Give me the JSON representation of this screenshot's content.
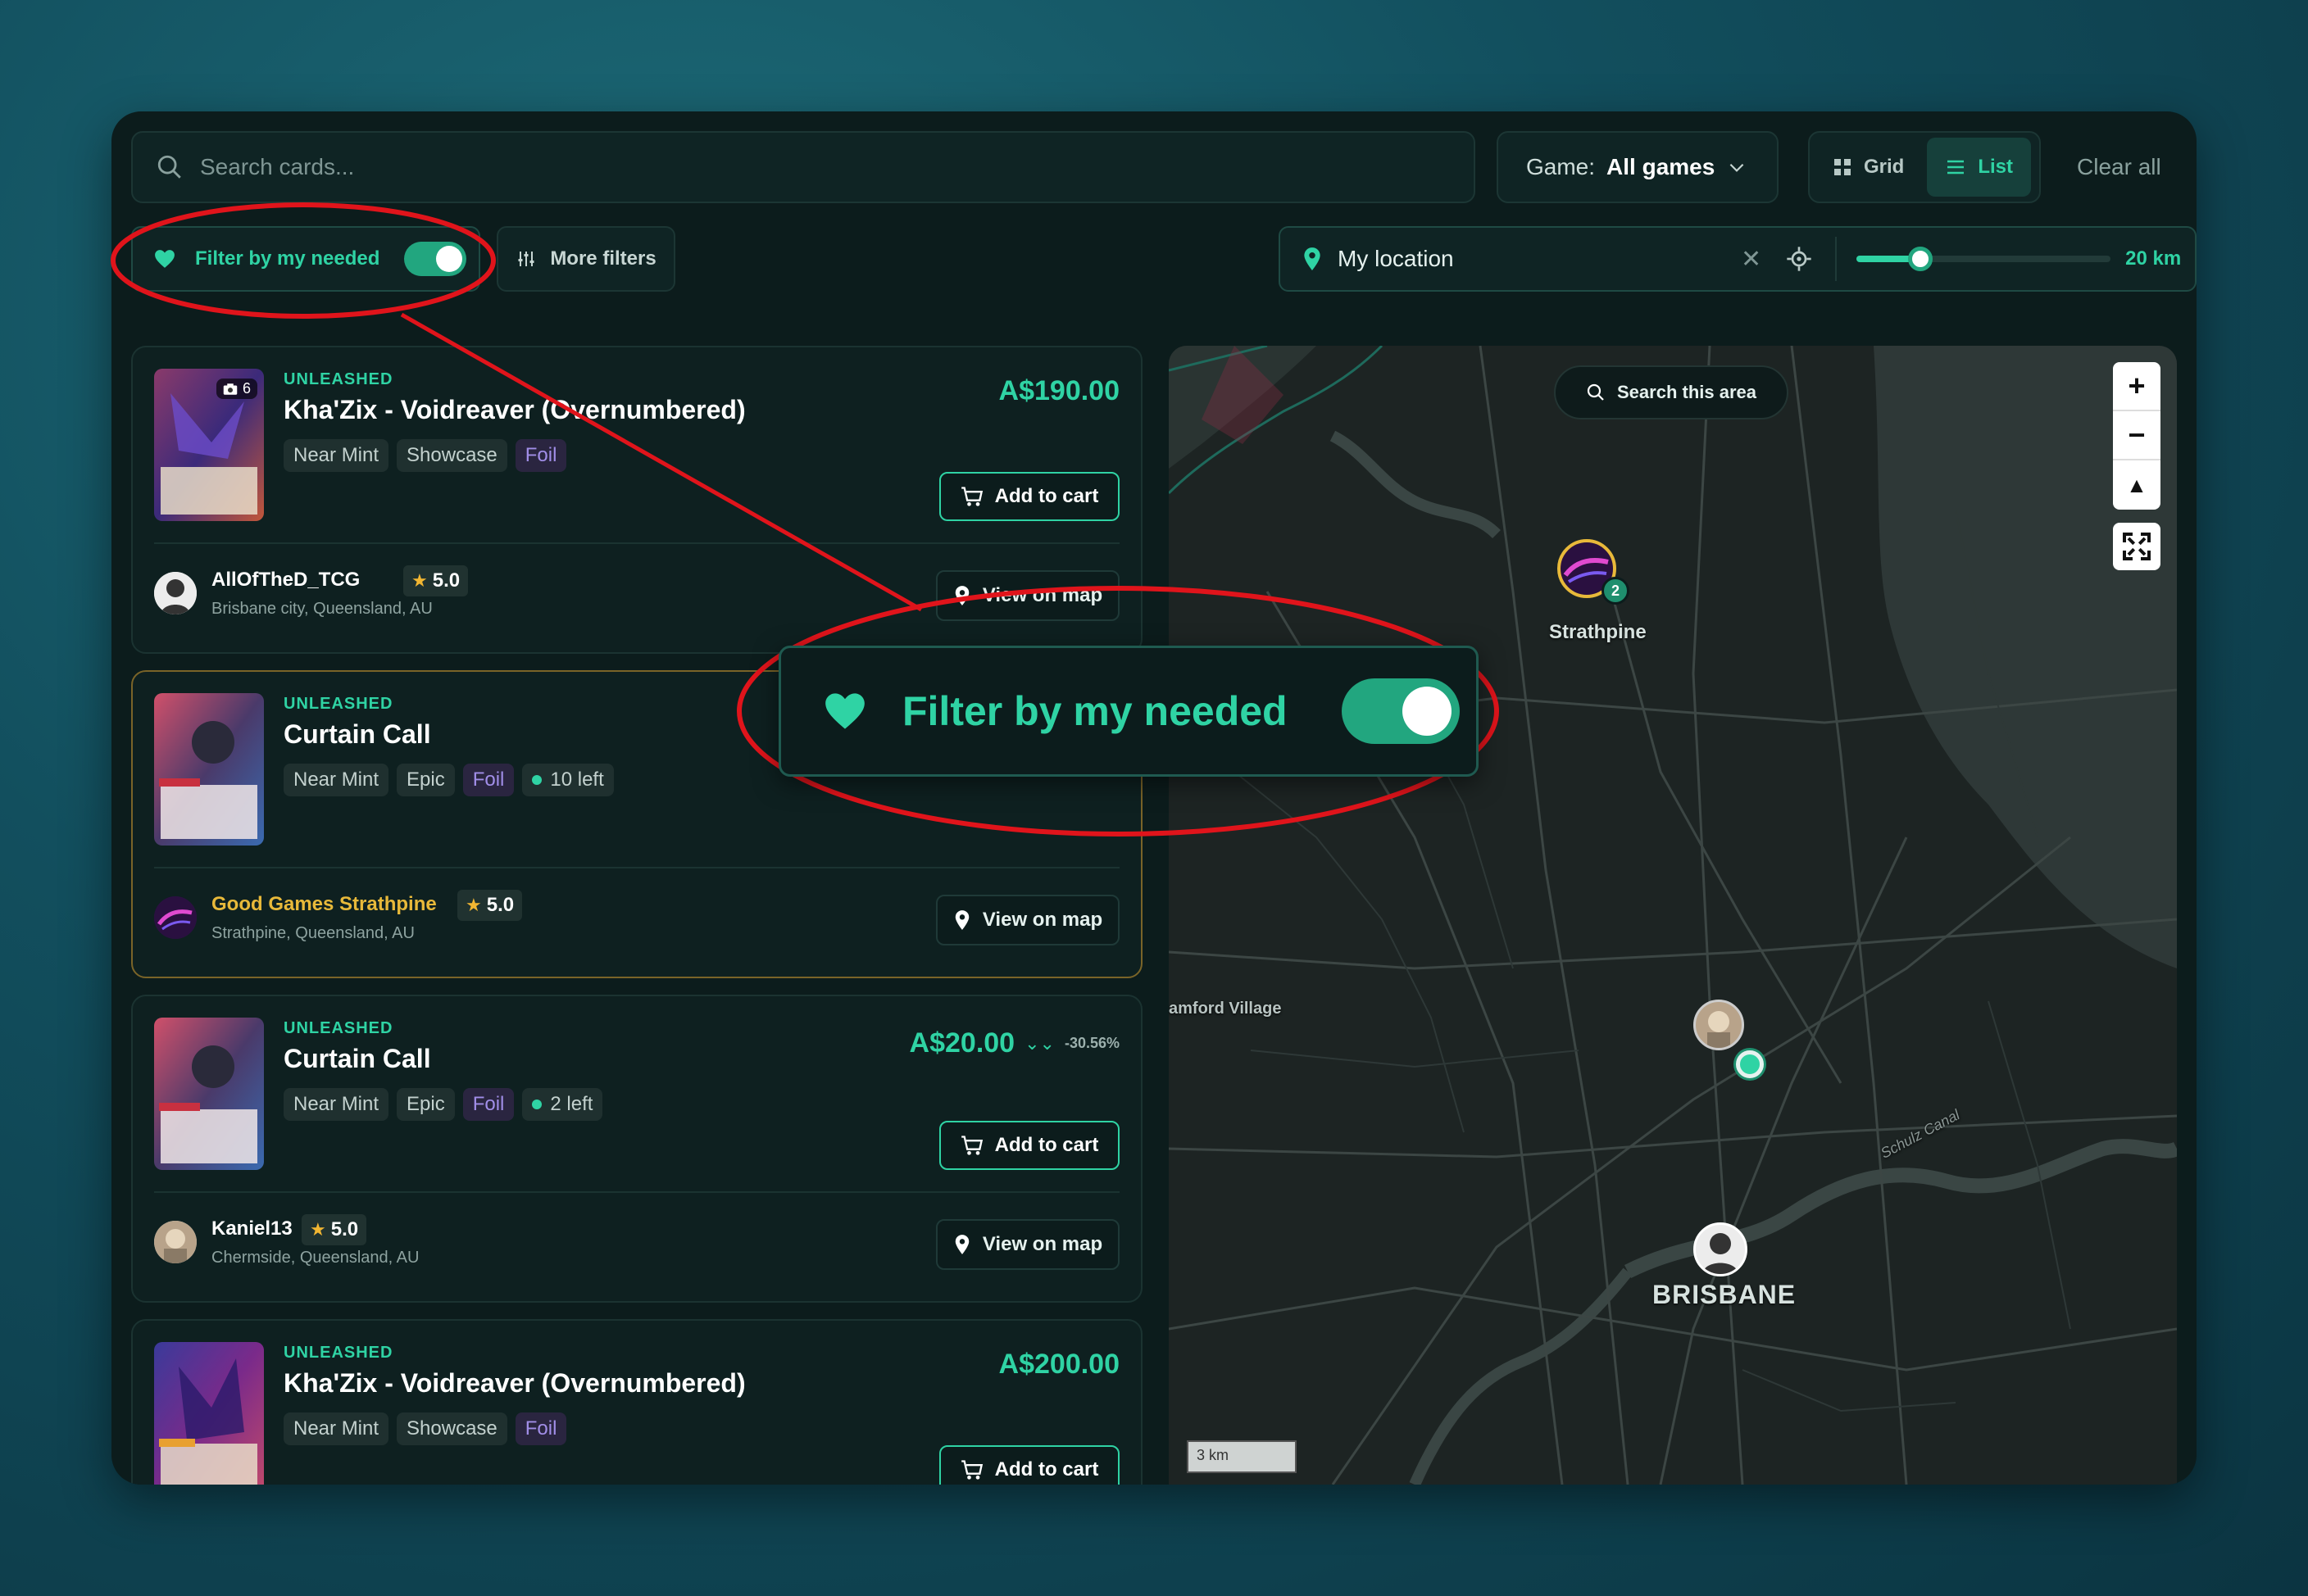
{
  "toolbar": {
    "search_placeholder": "Search cards...",
    "game_label": "Game:",
    "game_value": "All games",
    "view_grid": "Grid",
    "view_list": "List",
    "active_view": "List",
    "clear_all": "Clear all"
  },
  "filters": {
    "needed_label": "Filter by my needed",
    "needed_enabled": true,
    "more_filters": "More filters"
  },
  "location": {
    "value": "My location",
    "radius_label": "20 km",
    "radius_fraction": 0.25
  },
  "listings": [
    {
      "set": "UNLEASHED",
      "name": "Kha'Zix - Voidreaver (Overnumbered)",
      "photo_count": "6",
      "tags": [
        "Near Mint",
        "Showcase",
        "Foil"
      ],
      "price": "A$190.00",
      "cart": "Add to cart",
      "seller": "AllOfTheD_TCG",
      "rating": "5.0",
      "seller_location": "Brisbane city, Queensland, AU",
      "map_button": "View on map"
    },
    {
      "set": "UNLEASHED",
      "name": "Curtain Call",
      "tags": [
        "Near Mint",
        "Epic",
        "Foil"
      ],
      "stock": "10 left",
      "seller": "Good Games Strathpine",
      "rating": "5.0",
      "seller_location": "Strathpine, Queensland, AU",
      "map_button": "View on map"
    },
    {
      "set": "UNLEASHED",
      "name": "Curtain Call",
      "tags": [
        "Near Mint",
        "Epic",
        "Foil"
      ],
      "stock": "2 left",
      "price": "A$20.00",
      "discount": "-30.56%",
      "cart": "Add to cart",
      "seller": "Kaniel13",
      "rating": "5.0",
      "seller_location": "Chermside, Queensland, AU",
      "map_button": "View on map"
    },
    {
      "set": "UNLEASHED",
      "name": "Kha'Zix - Voidreaver (Overnumbered)",
      "tags": [
        "Near Mint",
        "Showcase",
        "Foil"
      ],
      "price": "A$200.00",
      "cart": "Add to cart"
    }
  ],
  "map": {
    "search_area": "Search this area",
    "zoom_in": "+",
    "zoom_out": "−",
    "labels": {
      "strathpine": "Strathpine",
      "brisbane": "BRISBANE",
      "stafford": "amford Village",
      "canal": "Schulz Canal"
    },
    "cluster_count": "2",
    "scale": "3 km"
  },
  "callout": {
    "label": "Filter by my needed"
  },
  "colors": {
    "accent": "#2fd3a4",
    "annotation": "#e0141b",
    "gold": "#e8b93a",
    "foil": "#a18ee8"
  }
}
